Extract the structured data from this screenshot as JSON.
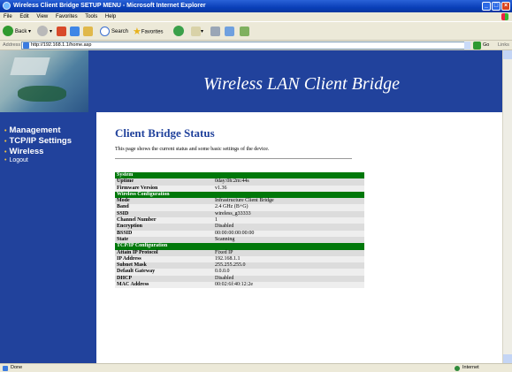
{
  "window": {
    "title": "Wireless Client Bridge SETUP MENU - Microsoft Internet Explorer"
  },
  "menu": [
    "File",
    "Edit",
    "View",
    "Favorites",
    "Tools",
    "Help"
  ],
  "toolbar": {
    "back": "Back",
    "search": "Search",
    "favorites": "Favorites"
  },
  "address": {
    "label": "Address",
    "url": "http://192.168.1.1/home.asp",
    "go": "Go",
    "links": "Links"
  },
  "banner": {
    "title": "Wireless LAN Client Bridge"
  },
  "nav": [
    {
      "label": "Management"
    },
    {
      "label": "TCP/IP Settings"
    },
    {
      "label": "Wireless"
    },
    {
      "label": "Logout"
    }
  ],
  "page": {
    "title": "Client Bridge Status",
    "description": "This page shows the current status and some basic settings of the device."
  },
  "status_table": {
    "rows": [
      {
        "type": "section",
        "label": "System"
      },
      {
        "type": "data",
        "key": "Uptime",
        "value": "0day:0h:2m:44s"
      },
      {
        "type": "data",
        "key": "Firmware Version",
        "value": "v1.36"
      },
      {
        "type": "section",
        "label": "Wireless Configuration"
      },
      {
        "type": "data",
        "key": "Mode",
        "value": "Infrastructure Client Bridge"
      },
      {
        "type": "data",
        "key": "Band",
        "value": "2.4 GHz (B+G)"
      },
      {
        "type": "data",
        "key": "SSID",
        "value": "wireless_g33333"
      },
      {
        "type": "data",
        "key": "Channel Number",
        "value": "1"
      },
      {
        "type": "data",
        "key": "Encryption",
        "value": "Disabled"
      },
      {
        "type": "data",
        "key": "BSSID",
        "value": "00:00:00:00:00:00"
      },
      {
        "type": "data",
        "key": "State",
        "value": "Scanning"
      },
      {
        "type": "section",
        "label": "TCP/IP Configuration"
      },
      {
        "type": "data",
        "key": "Attain IP Protocol",
        "value": "Fixed IP"
      },
      {
        "type": "data",
        "key": "IP Address",
        "value": "192.168.1.1"
      },
      {
        "type": "data",
        "key": "Subnet Mask",
        "value": "255.255.255.0"
      },
      {
        "type": "data",
        "key": "Default Gateway",
        "value": "0.0.0.0"
      },
      {
        "type": "data",
        "key": "DHCP",
        "value": "Disabled"
      },
      {
        "type": "data",
        "key": "MAC Address",
        "value": "00:02:6f:40:12:2e"
      }
    ]
  },
  "statusbar": {
    "left": "Done",
    "right": "Internet"
  }
}
